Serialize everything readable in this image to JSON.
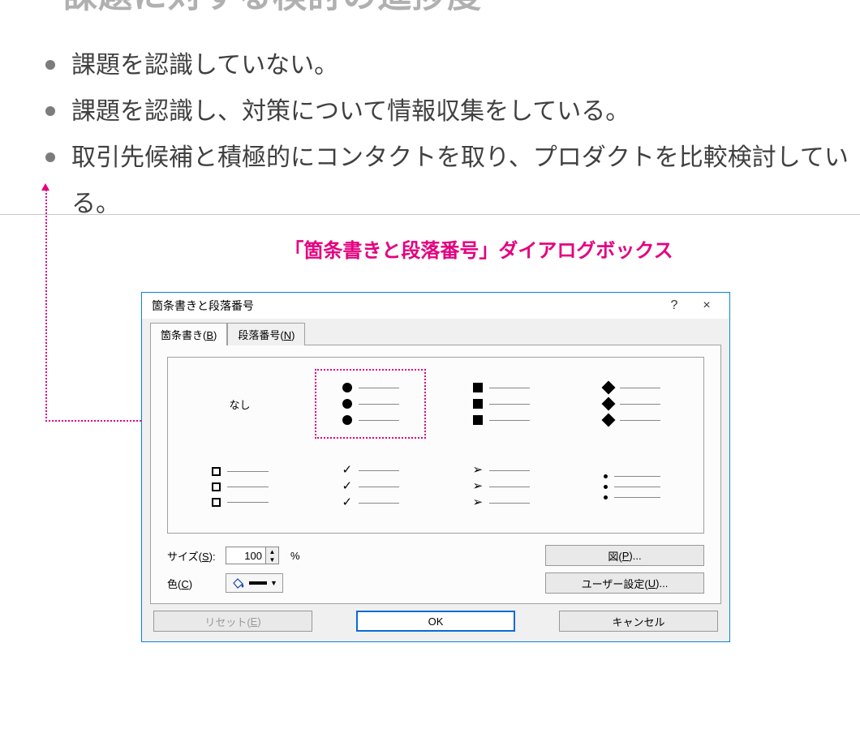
{
  "slide": {
    "title": "課題に対する検討の進捗度",
    "bullets": [
      "課題を認識していない。",
      "課題を認識し、対策について情報収集をしている。",
      "取引先候補と積極的にコンタクトを取り、プロダクトを比較検討している。"
    ]
  },
  "callout": {
    "title": "「箇条書きと段落番号」ダイアログボックス"
  },
  "dialog": {
    "title": "箇条書きと段落番号",
    "help": "?",
    "close": "×",
    "tabs": {
      "bullets": {
        "label_pre": "箇条書き(",
        "accel": "B",
        "label_post": ")"
      },
      "numbers": {
        "label_pre": "段落番号(",
        "accel": "N",
        "label_post": ")"
      }
    },
    "none_label": "なし",
    "size": {
      "label_pre": "サイズ(",
      "accel": "S",
      "label_post": "):",
      "value": "100",
      "unit": "%"
    },
    "color": {
      "label_pre": "色(",
      "accel": "C",
      "label_post": ")"
    },
    "picture_btn": {
      "pre": "図(",
      "accel": "P",
      "post": ")..."
    },
    "customize_btn": {
      "pre": "ユーザー設定(",
      "accel": "U",
      "post": ")..."
    },
    "reset_btn": {
      "pre": "リセット(",
      "accel": "E",
      "post": ")"
    },
    "ok": "OK",
    "cancel": "キャンセル"
  }
}
